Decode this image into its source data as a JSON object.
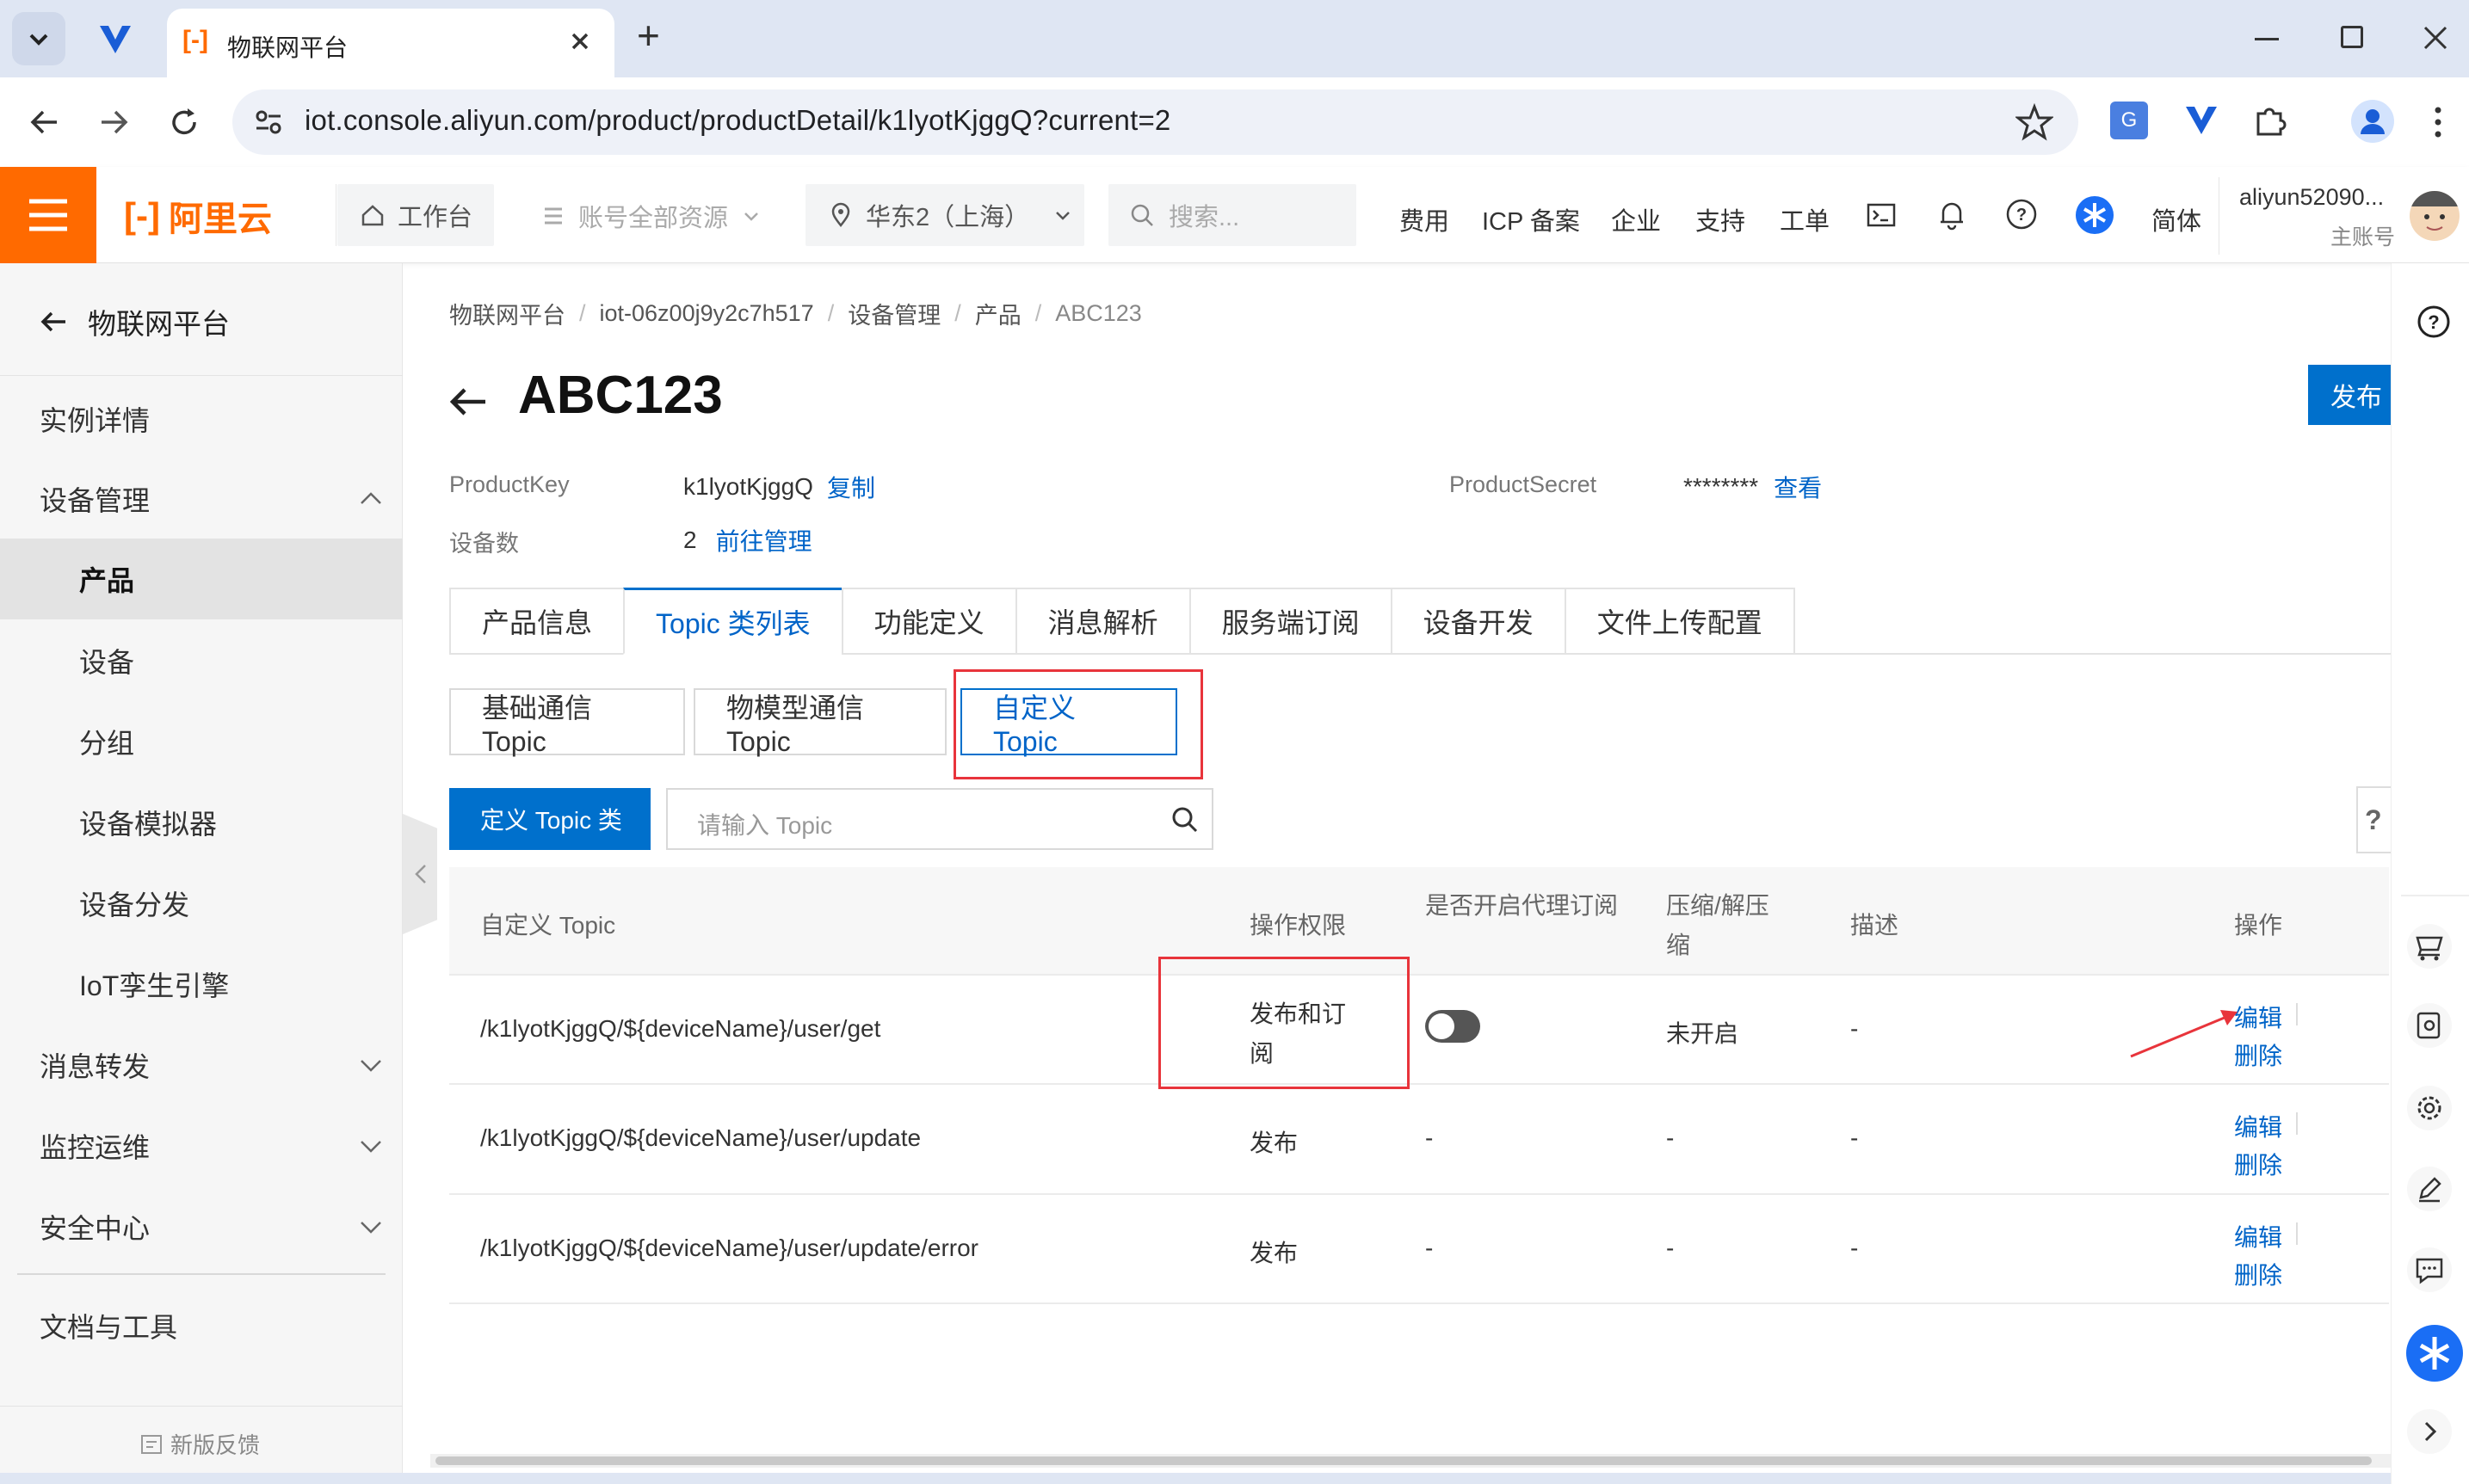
{
  "browser": {
    "tab_title": "物联网平台",
    "url": "iot.console.aliyun.com/product/productDetail/k1lyotKjggQ?current=2",
    "new_tab": "+"
  },
  "topbar": {
    "logo_text": "阿里云",
    "workbench": "工作台",
    "account_resources": "账号全部资源",
    "region": "华东2（上海）",
    "search_placeholder": "搜索...",
    "links": [
      "费用",
      "ICP 备案",
      "企业",
      "支持",
      "工单"
    ],
    "lang": "简体",
    "user_name": "aliyun52090...",
    "user_role": "主账号"
  },
  "sidebar": {
    "back_label": "物联网平台",
    "items": [
      {
        "label": "实例详情"
      },
      {
        "label": "设备管理"
      },
      {
        "label": "产品"
      },
      {
        "label": "设备"
      },
      {
        "label": "分组"
      },
      {
        "label": "设备模拟器"
      },
      {
        "label": "设备分发"
      },
      {
        "label": "IoT孪生引擎"
      },
      {
        "label": "消息转发"
      },
      {
        "label": "监控运维"
      },
      {
        "label": "安全中心"
      },
      {
        "label": "文档与工具"
      }
    ],
    "feedback": "新版反馈"
  },
  "breadcrumb": [
    "物联网平台",
    "iot-06z00j9y2c7h517",
    "设备管理",
    "产品",
    "ABC123"
  ],
  "page": {
    "title": "ABC123",
    "publish_button": "发布",
    "product_key_label": "ProductKey",
    "product_key_value": "k1lyotKjggQ",
    "copy": "复制",
    "product_secret_label": "ProductSecret",
    "product_secret_value": "********",
    "view": "查看",
    "device_count_label": "设备数",
    "device_count_value": "2",
    "manage": "前往管理"
  },
  "tabs": [
    "产品信息",
    "Topic 类列表",
    "功能定义",
    "消息解析",
    "服务端订阅",
    "设备开发",
    "文件上传配置"
  ],
  "subtabs": [
    "基础通信 Topic",
    "物模型通信 Topic",
    "自定义 Topic"
  ],
  "toolbar": {
    "define_button": "定义 Topic 类",
    "search_placeholder": "请输入 Topic",
    "help": "?"
  },
  "table": {
    "headers": [
      "自定义 Topic",
      "操作权限",
      "是否开启代理订阅",
      "压缩/解压缩",
      "描述",
      "操作"
    ],
    "rows": [
      {
        "topic": "/k1lyotKjggQ/${deviceName}/user/get",
        "perm": "发布和订阅",
        "proxy": "toggle-off",
        "compress": "未开启",
        "desc": "-",
        "edit": "编辑",
        "delete": "删除"
      },
      {
        "topic": "/k1lyotKjggQ/${deviceName}/user/update",
        "perm": "发布",
        "proxy": "-",
        "compress": "-",
        "desc": "-",
        "edit": "编辑",
        "delete": "删除"
      },
      {
        "topic": "/k1lyotKjggQ/${deviceName}/user/update/error",
        "perm": "发布",
        "proxy": "-",
        "compress": "-",
        "desc": "-",
        "edit": "编辑",
        "delete": "删除"
      }
    ]
  },
  "colors": {
    "brand_orange": "#ff6a00",
    "link_blue": "#0064c8",
    "primary_button": "#0070cc",
    "highlight_red": "#e8343b"
  }
}
